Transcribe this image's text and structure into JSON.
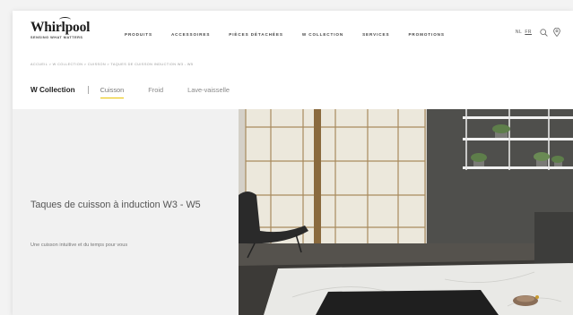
{
  "brand": {
    "name": "Whirlpool",
    "tagline": "SENSING WHAT MATTERS"
  },
  "nav": [
    "PRODUITS",
    "ACCESSOIRES",
    "PIÈCES DÉTACHÉES",
    "W COLLECTION",
    "SERVICES",
    "PROMOTIONS"
  ],
  "lang": {
    "nl": "NL",
    "fr": "FR",
    "active": "FR"
  },
  "icons": {
    "search": "search-icon",
    "location": "location-pin-icon"
  },
  "breadcrumb": "ACCUEIL > W COLLECTION > CUISSON > TAQUES DE CUISSON INDUCTION W3 - W5",
  "subnav": {
    "title": "W Collection",
    "items": [
      "Cuisson",
      "Froid",
      "Lave-vaisselle"
    ],
    "active": "Cuisson"
  },
  "hero": {
    "title": "Taques de cuisson à induction W3 - W5",
    "description": "Une cuisson intuitive et du temps pour vous"
  },
  "colors": {
    "accent": "#e8c200",
    "text": "#333333",
    "hero_bg": "#f1f1f1"
  }
}
